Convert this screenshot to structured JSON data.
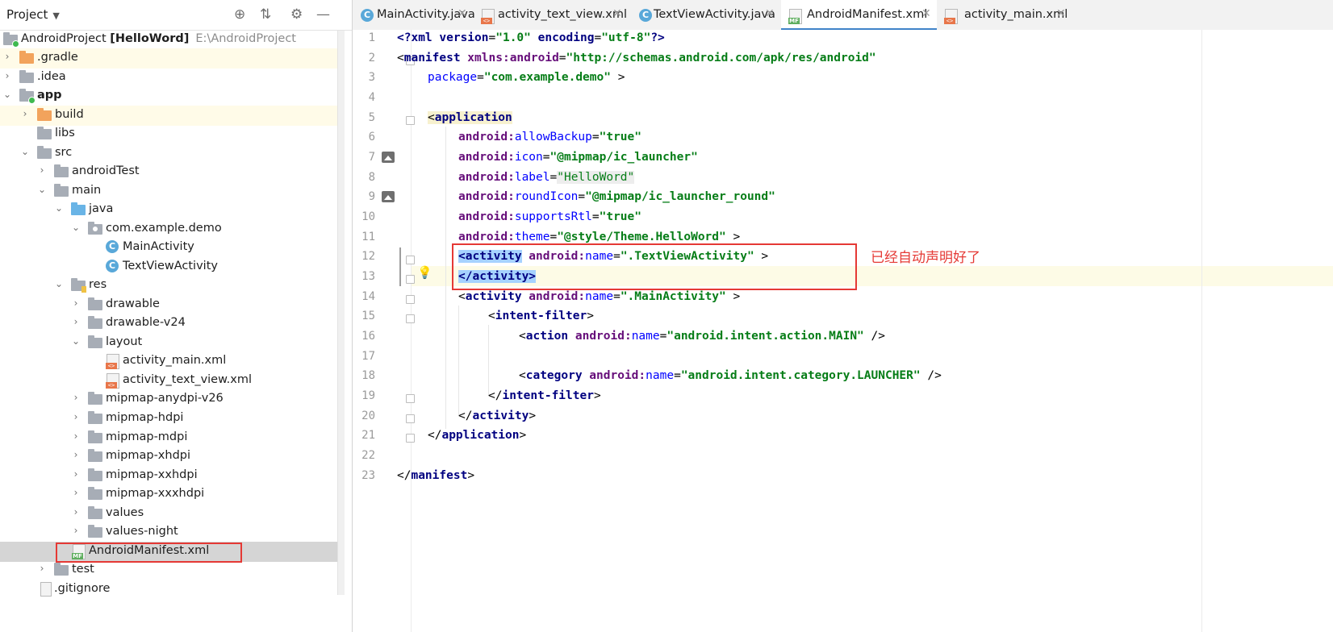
{
  "project_panel": {
    "title": "Project",
    "tree": [
      {
        "label": "AndroidProject",
        "bold_suffix": "[HelloWord]",
        "extra": "E:\\AndroidProject"
      },
      {
        "label": ".gradle"
      },
      {
        "label": ".idea"
      },
      {
        "label": "app"
      },
      {
        "label": "build"
      },
      {
        "label": "libs"
      },
      {
        "label": "src"
      },
      {
        "label": "androidTest"
      },
      {
        "label": "main"
      },
      {
        "label": "java"
      },
      {
        "label": "com.example.demo"
      },
      {
        "label": "MainActivity"
      },
      {
        "label": "TextViewActivity"
      },
      {
        "label": "res"
      },
      {
        "label": "drawable"
      },
      {
        "label": "drawable-v24"
      },
      {
        "label": "layout"
      },
      {
        "label": "activity_main.xml"
      },
      {
        "label": "activity_text_view.xml"
      },
      {
        "label": "mipmap-anydpi-v26"
      },
      {
        "label": "mipmap-hdpi"
      },
      {
        "label": "mipmap-mdpi"
      },
      {
        "label": "mipmap-xhdpi"
      },
      {
        "label": "mipmap-xxhdpi"
      },
      {
        "label": "mipmap-xxxhdpi"
      },
      {
        "label": "values"
      },
      {
        "label": "values-night"
      },
      {
        "label": "AndroidManifest.xml"
      },
      {
        "label": "test"
      },
      {
        "label": ".gitignore"
      }
    ]
  },
  "tabs": [
    {
      "label": "MainActivity.java"
    },
    {
      "label": "activity_text_view.xml"
    },
    {
      "label": "TextViewActivity.java"
    },
    {
      "label": "AndroidManifest.xml"
    },
    {
      "label": "activity_main.xml"
    }
  ],
  "active_tab": "AndroidManifest.xml",
  "editor": {
    "line_numbers": [
      "1",
      "2",
      "3",
      "4",
      "5",
      "6",
      "7",
      "8",
      "9",
      "10",
      "11",
      "12",
      "13",
      "14",
      "15",
      "16",
      "17",
      "18",
      "19",
      "20",
      "21",
      "22",
      "23"
    ],
    "lines": {
      "l1": {
        "t1": "<?",
        "t2": "xml version",
        "t3": "=",
        "t4": "\"1.0\"",
        "t5": " encoding",
        "t6": "=",
        "t7": "\"utf-8\"",
        "t8": "?>"
      },
      "l2": {
        "t1": "<",
        "t2": "manifest",
        "t3": " xmlns:",
        "t4": "android",
        "t5": "=",
        "t6": "\"http://schemas.android.com/apk/res/android\""
      },
      "l3": {
        "t1": "package",
        "t2": "=",
        "t3": "\"com.example.demo\"",
        "t4": " >"
      },
      "l5": {
        "t1": "<",
        "t2": "application"
      },
      "l6": {
        "t1": "android:",
        "t2": "allowBackup",
        "t3": "=",
        "t4": "\"true\""
      },
      "l7": {
        "t1": "android:",
        "t2": "icon",
        "t3": "=",
        "t4": "\"@mipmap/ic_launcher\""
      },
      "l8": {
        "t1": "android:",
        "t2": "label",
        "t3": "=",
        "t4": "\"HelloWord\""
      },
      "l9": {
        "t1": "android:",
        "t2": "roundIcon",
        "t3": "=",
        "t4": "\"@mipmap/ic_launcher_round\""
      },
      "l10": {
        "t1": "android:",
        "t2": "supportsRtl",
        "t3": "=",
        "t4": "\"true\""
      },
      "l11": {
        "t1": "android:",
        "t2": "theme",
        "t3": "=",
        "t4": "\"@style/Theme.HelloWord\"",
        "t5": " >"
      },
      "l12": {
        "t1": "<activity",
        "t2": " android:",
        "t3": "name",
        "t4": "=",
        "t5": "\".TextViewActivity\"",
        "t6": " >"
      },
      "l13": {
        "t1": "</activity>"
      },
      "l14": {
        "t1": "<",
        "t2": "activity",
        "t3": " android:",
        "t4": "name",
        "t5": "=",
        "t6": "\".MainActivity\"",
        "t7": " >"
      },
      "l15": {
        "t1": "<",
        "t2": "intent-filter",
        "t3": ">"
      },
      "l16": {
        "t1": "<",
        "t2": "action",
        "t3": " android:",
        "t4": "name",
        "t5": "=",
        "t6": "\"android.intent.action.MAIN\"",
        "t7": " />"
      },
      "l18": {
        "t1": "<",
        "t2": "category",
        "t3": " android:",
        "t4": "name",
        "t5": "=",
        "t6": "\"android.intent.category.LAUNCHER\"",
        "t7": " />"
      },
      "l19": {
        "t1": "</",
        "t2": "intent-filter",
        "t3": ">"
      },
      "l20": {
        "t1": "</",
        "t2": "activity",
        "t3": ">"
      },
      "l21": {
        "t1": "</",
        "t2": "application",
        "t3": ">"
      },
      "l23": {
        "t1": "</",
        "t2": "manifest",
        "t3": ">"
      }
    }
  },
  "annotation": "已经自动声明好了",
  "colors": {
    "highlight_box": "#e53935",
    "tab_underline": "#4083c9",
    "selection": "#a6d2ff"
  }
}
